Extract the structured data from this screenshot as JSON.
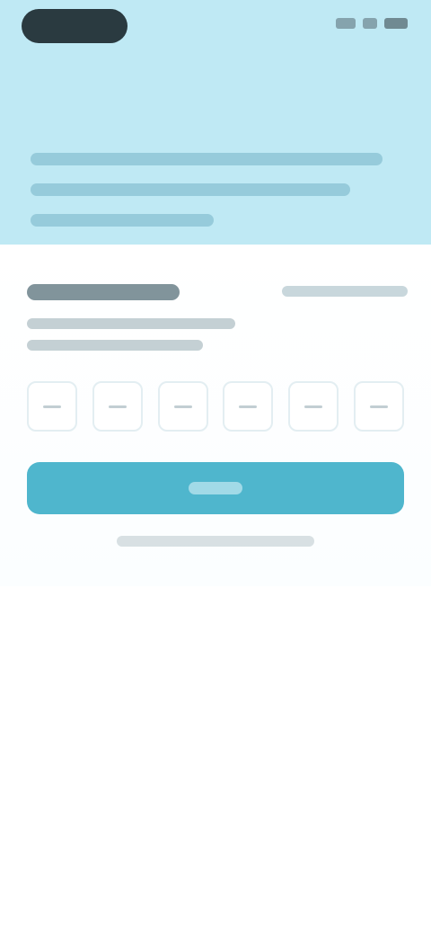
{
  "status_bar": {
    "icons": [
      "signal-icon",
      "wifi-icon",
      "battery-icon"
    ]
  },
  "hero": {
    "background": "#bfe9f4",
    "title": "",
    "body_lines": 3
  },
  "form": {
    "title": "",
    "right_link": "",
    "subtitle_lines": 2,
    "otp_slots": 6,
    "primary_button": "",
    "footer_link": ""
  },
  "colors": {
    "accent": "#4fb6cd",
    "hero_bg": "#bfe9f4",
    "text_dark": "#2c5566"
  }
}
